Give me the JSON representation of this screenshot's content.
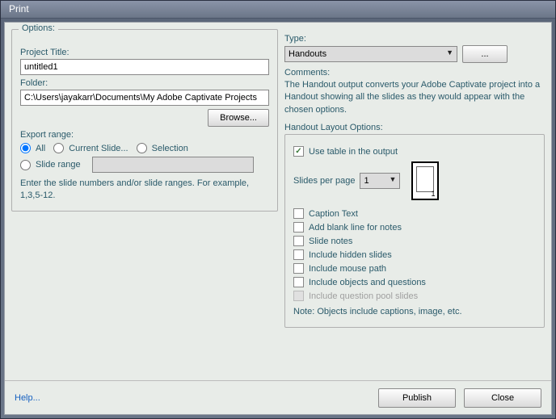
{
  "window": {
    "title": "Print"
  },
  "left": {
    "group_title": "Options:",
    "project_title_label": "Project Title:",
    "project_title_value": "untitled1",
    "folder_label": "Folder:",
    "folder_value": "C:\\Users\\jayakarr\\Documents\\My Adobe Captivate Projects",
    "browse": "Browse...",
    "export_range_label": "Export range:",
    "radio_all": "All",
    "radio_current": "Current Slide...",
    "radio_selection": "Selection",
    "radio_slide_range": "Slide range",
    "slide_range_value": "",
    "hint": "Enter the slide numbers and/or slide ranges. For example, 1,3,5-12."
  },
  "right": {
    "type_label": "Type:",
    "type_value": "Handouts",
    "dots": "...",
    "comments_label": "Comments:",
    "comments_text": "The Handout output converts your Adobe Captivate project into a Handout showing all the slides as they would appear with the chosen options.",
    "layout_group": "Handout Layout Options:",
    "use_table": "Use table in the output",
    "slides_per_page": "Slides per page",
    "slides_per_page_value": "1",
    "thumb_num": "1",
    "caption_text": "Caption Text",
    "add_blank": "Add blank line for notes",
    "slide_notes": "Slide notes",
    "include_hidden": "Include hidden slides",
    "include_mouse": "Include mouse path",
    "include_objects": "Include objects and questions",
    "include_pool": "Include question pool slides",
    "note": "Note: Objects include captions, image, etc."
  },
  "footer": {
    "help": "Help...",
    "publish": "Publish",
    "close": "Close"
  }
}
